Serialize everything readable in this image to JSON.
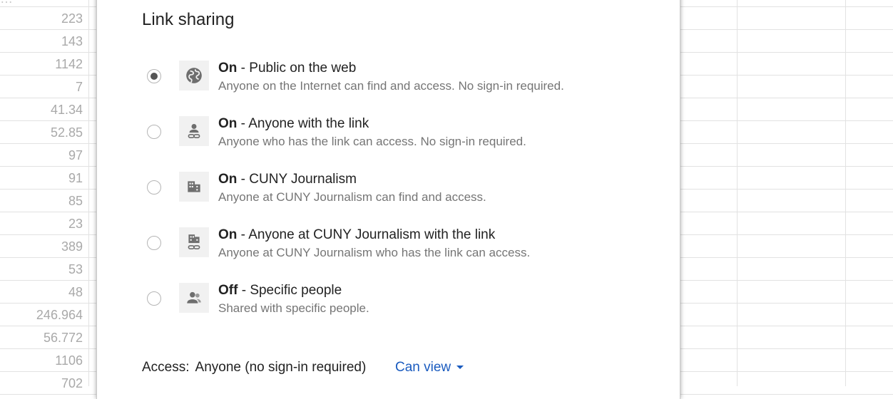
{
  "sheet": {
    "column_values": [
      "223",
      "143",
      "1142",
      "7",
      "41.34",
      "52.85",
      "97",
      "91",
      "85",
      "23",
      "389",
      "53",
      "48",
      "246.964",
      "56.772",
      "1106",
      "702"
    ]
  },
  "dialog": {
    "title": "Link sharing",
    "options": [
      {
        "status": "On",
        "label": " - Public on the web",
        "description": "Anyone on the Internet can find and access. No sign-in required.",
        "icon": "globe-icon",
        "selected": true
      },
      {
        "status": "On",
        "label": " - Anyone with the link",
        "description": "Anyone who has the link can access. No sign-in required.",
        "icon": "person-link-icon",
        "selected": false
      },
      {
        "status": "On",
        "label": " - CUNY Journalism",
        "description": "Anyone at CUNY Journalism can find and access.",
        "icon": "domain-icon",
        "selected": false
      },
      {
        "status": "On",
        "label": " - Anyone at CUNY Journalism with the link",
        "description": "Anyone at CUNY Journalism who has the link can access.",
        "icon": "domain-link-icon",
        "selected": false
      },
      {
        "status": "Off",
        "label": " - Specific people",
        "description": "Shared with specific people.",
        "icon": "people-icon",
        "selected": false
      }
    ],
    "access": {
      "label": "Access:",
      "value": "Anyone (no sign-in required)",
      "permission": "Can view"
    }
  },
  "colors": {
    "link_blue": "#1a5bbf",
    "icon_gray": "#6e6e6e"
  }
}
